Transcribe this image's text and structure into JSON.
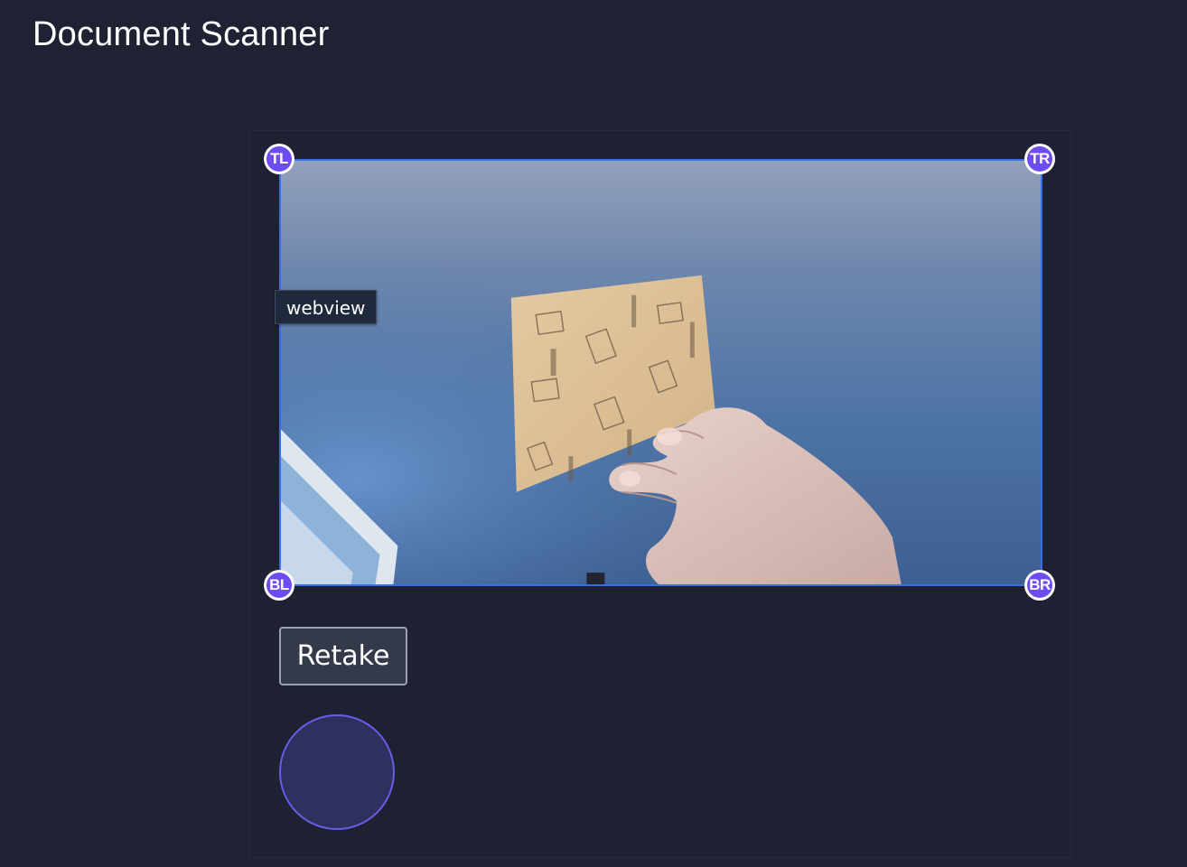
{
  "header": {
    "title": "Document Scanner"
  },
  "scanner": {
    "image_description": "camera-preview-hand-holding-sticky-note",
    "accent_color": "#3b6fe0",
    "handles": {
      "tl": "TL",
      "tr": "TR",
      "bl": "BL",
      "br": "BR"
    },
    "handle_color": "#6d4cf0"
  },
  "tooltip": {
    "text": "webview"
  },
  "actions": {
    "retake_label": "Retake",
    "capture_icon": "capture-circle-icon"
  }
}
